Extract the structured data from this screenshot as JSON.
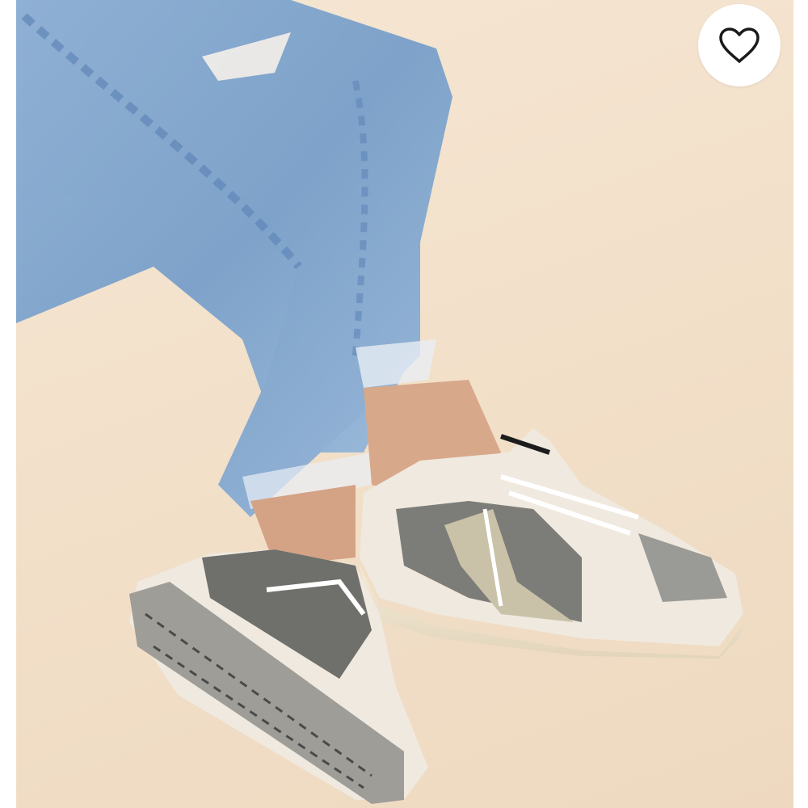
{
  "product_image": {
    "alt_description": "",
    "background_color": "#f2dfc8"
  },
  "favorite": {
    "icon": "heart-outline-icon",
    "active": false,
    "icon_color": "#1a1a1a"
  }
}
